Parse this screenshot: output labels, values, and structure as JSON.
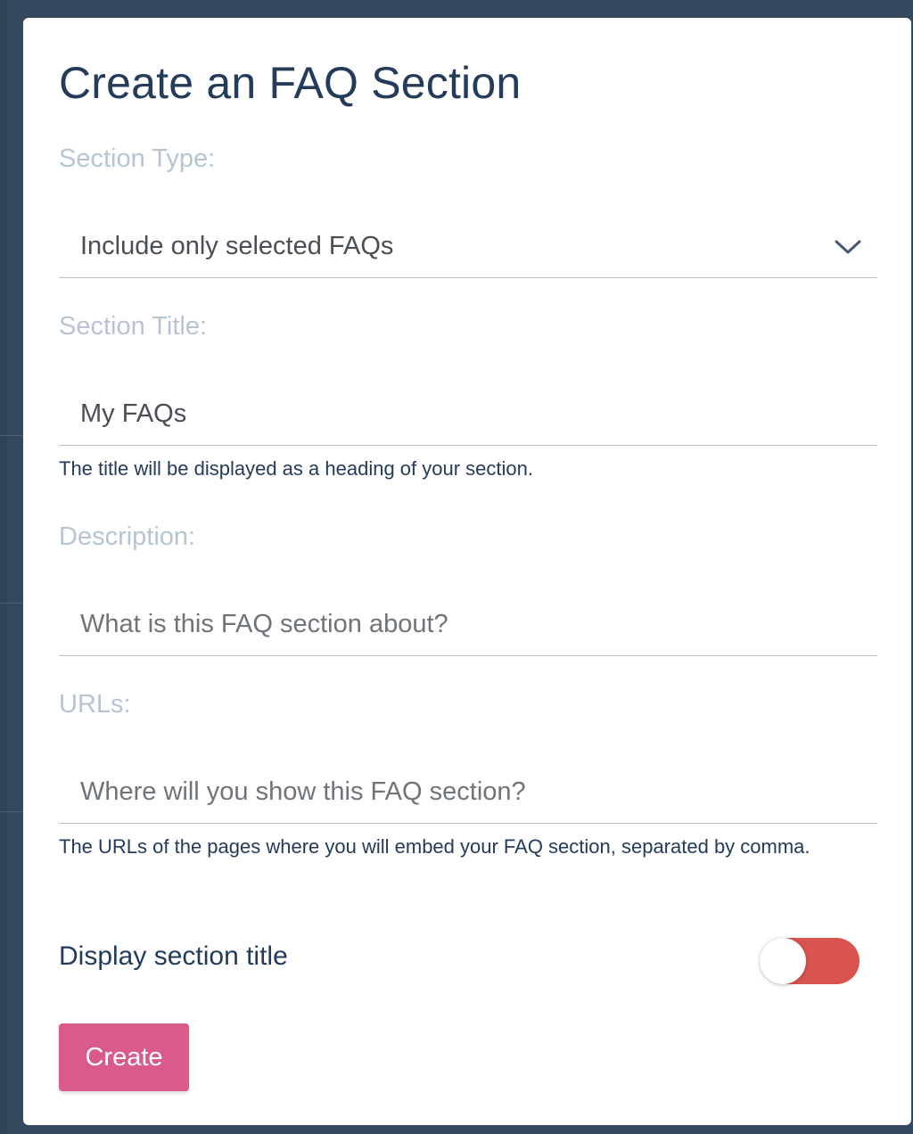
{
  "modal": {
    "title": "Create an FAQ Section"
  },
  "section_type": {
    "label": "Section Type:",
    "selected": "Include only selected FAQs"
  },
  "section_title": {
    "label": "Section Title:",
    "value": "My FAQs",
    "help": "The title will be displayed as a heading of your section."
  },
  "description": {
    "label": "Description:",
    "value": "",
    "placeholder": "What is this FAQ section about?"
  },
  "urls": {
    "label": "URLs:",
    "value": "",
    "placeholder": "Where will you show this FAQ section?",
    "help": "The URLs of the pages where you will embed your FAQ section, separated by comma."
  },
  "display_title": {
    "label": "Display section title",
    "enabled": false,
    "track_color": "#d9534f"
  },
  "actions": {
    "create_label": "Create",
    "create_color": "#da5a8a"
  },
  "colors": {
    "backdrop": "#34495e",
    "heading": "#243b5a",
    "label": "#b7c4d3"
  }
}
